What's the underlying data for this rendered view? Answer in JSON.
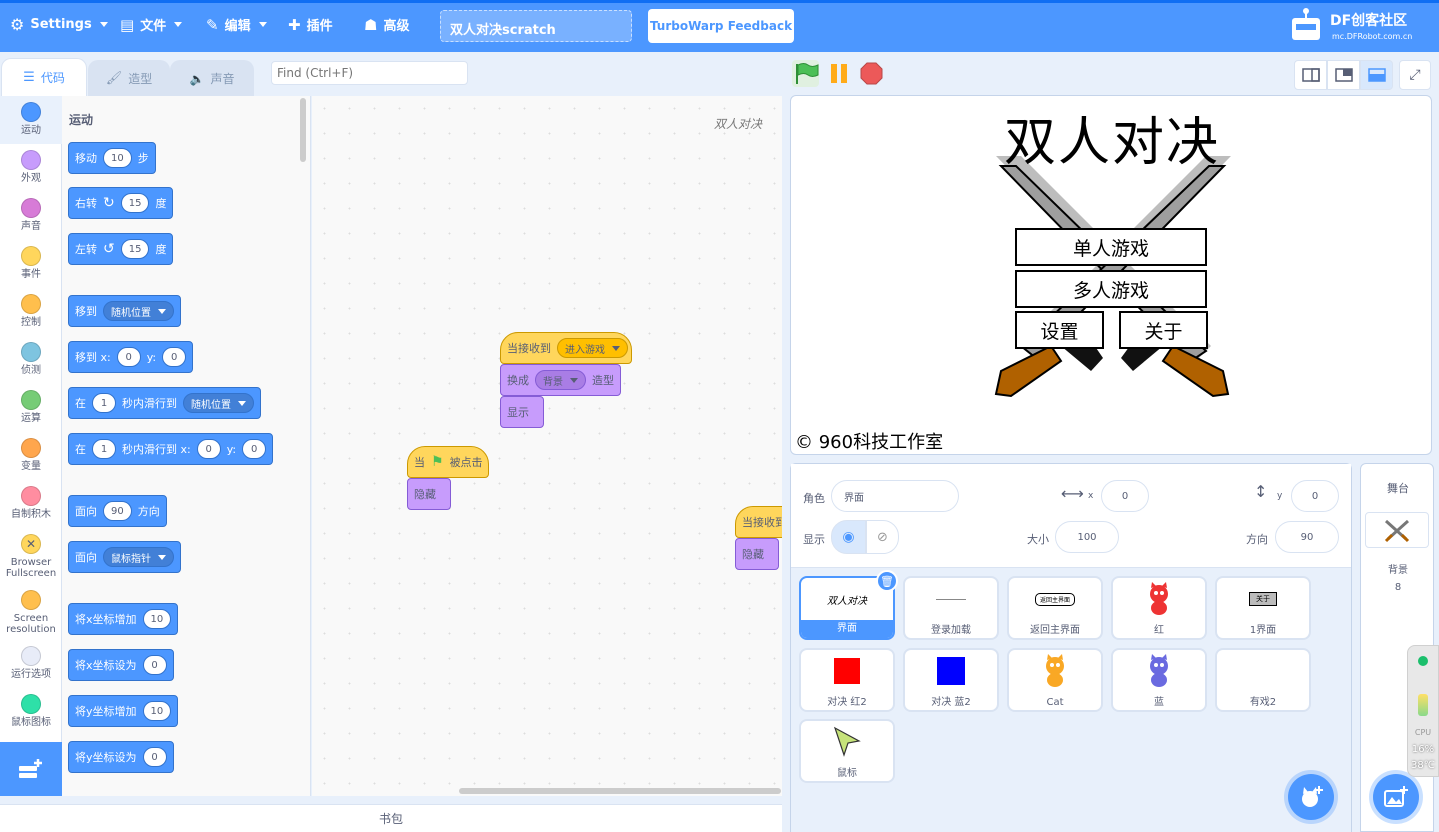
{
  "menubar": {
    "settings": "Settings",
    "file": "文件",
    "edit": "编辑",
    "addons": "插件",
    "advanced": "高级",
    "project_title": "双人对决scratch",
    "feedback": "TurboWarp Feedback",
    "logo_brand": "DF创客社区",
    "logo_url": "mc.DFRobot.com.cn"
  },
  "tabs": {
    "code": "代码",
    "costumes": "造型",
    "sounds": "声音"
  },
  "search": {
    "placeholder": "Find (Ctrl+F)"
  },
  "categories": [
    {
      "label": "运动",
      "color": "#4c97ff"
    },
    {
      "label": "外观",
      "color": "#9966ff"
    },
    {
      "label": "声音",
      "color": "#cf63cf"
    },
    {
      "label": "事件",
      "color": "#ffbf00"
    },
    {
      "label": "控制",
      "color": "#ffab19"
    },
    {
      "label": "侦测",
      "color": "#5cb1d6"
    },
    {
      "label": "运算",
      "color": "#59c059"
    },
    {
      "label": "变量",
      "color": "#ff8c1a"
    },
    {
      "label": "自制积木",
      "color": "#ff6680"
    },
    {
      "label": "Browser Fullscreen",
      "color": "#ffbf00"
    },
    {
      "label": "Screen resolution",
      "color": "#ffab19"
    },
    {
      "label": "运行选项",
      "color": "#e0e0f0"
    },
    {
      "label": "鼠标图标",
      "color": "#00d68f"
    }
  ],
  "palette": {
    "section_title": "运动",
    "move": {
      "a": "移动",
      "v": "10",
      "b": "步"
    },
    "turn_right": {
      "a": "右转",
      "v": "15",
      "b": "度"
    },
    "turn_left": {
      "a": "左转",
      "v": "15",
      "b": "度"
    },
    "goto": {
      "a": "移到",
      "d": "随机位置"
    },
    "goto_xy": {
      "a": "移到 x:",
      "x": "0",
      "y_label": "y:",
      "y": "0"
    },
    "glide": {
      "a": "在",
      "v": "1",
      "b": "秒内滑行到",
      "d": "随机位置"
    },
    "glide_xy": {
      "a": "在",
      "v": "1",
      "b": "秒内滑行到 x:",
      "x": "0",
      "y_label": "y:",
      "y": "0"
    },
    "point_dir": {
      "a": "面向",
      "v": "90",
      "b": "方向"
    },
    "point_towards": {
      "a": "面向",
      "d": "鼠标指针"
    },
    "change_x": {
      "a": "将x坐标增加",
      "v": "10"
    },
    "set_x": {
      "a": "将x坐标设为",
      "v": "0"
    },
    "change_y": {
      "a": "将y坐标增加",
      "v": "10"
    },
    "set_y": {
      "a": "将y坐标设为",
      "v": "0"
    }
  },
  "script": {
    "watermark": "双人对决",
    "s1_hat": "当接收到",
    "s1_msg": "进入游戏",
    "s1_switch": "换成",
    "s1_costume": "背景",
    "s1_costume_suffix": "造型",
    "s1_show": "显示",
    "s2_when": "当",
    "s2_clicked": "被点击",
    "s2_hide": "隐藏",
    "s3_hat": "当接收到",
    "s3_hide": "隐藏"
  },
  "backpack": "书包",
  "stage": {
    "title": "双人对决",
    "btn_single": "单人游戏",
    "btn_multi": "多人游戏",
    "btn_settings": "设置",
    "btn_about": "关于",
    "copyright": "© 960科技工作室"
  },
  "sprite_info": {
    "sprite_label": "角色",
    "sprite_name": "界面",
    "x_label": "x",
    "x_value": "0",
    "y_label": "y",
    "y_value": "0",
    "show_label": "显示",
    "size_label": "大小",
    "size_value": "100",
    "direction_label": "方向",
    "direction_value": "90"
  },
  "sprites": [
    {
      "name": "界面",
      "thumb": "双人对决"
    },
    {
      "name": "登录加载",
      "thumb": ""
    },
    {
      "name": "返回主界面",
      "thumb": "返回主界面"
    },
    {
      "name": "红",
      "thumb": ""
    },
    {
      "name": "1界面",
      "thumb": "关于"
    },
    {
      "name": "对决 红2",
      "thumb": ""
    },
    {
      "name": "对决 蓝2",
      "thumb": ""
    },
    {
      "name": "Cat",
      "thumb": ""
    },
    {
      "name": "蓝",
      "thumb": ""
    },
    {
      "name": "有戏2",
      "thumb": ""
    },
    {
      "name": "鼠标",
      "thumb": ""
    }
  ],
  "stage_panel": {
    "title": "舞台",
    "backdrops_label": "背景",
    "backdrops_count": "8"
  },
  "cpu": {
    "label": "CPU",
    "percent": "16%",
    "temp": "38℃"
  },
  "colors": {
    "accent": "#4c97ff",
    "motion": "#4c97ff",
    "events": "#ffbf00",
    "looks": "#9966ff"
  }
}
